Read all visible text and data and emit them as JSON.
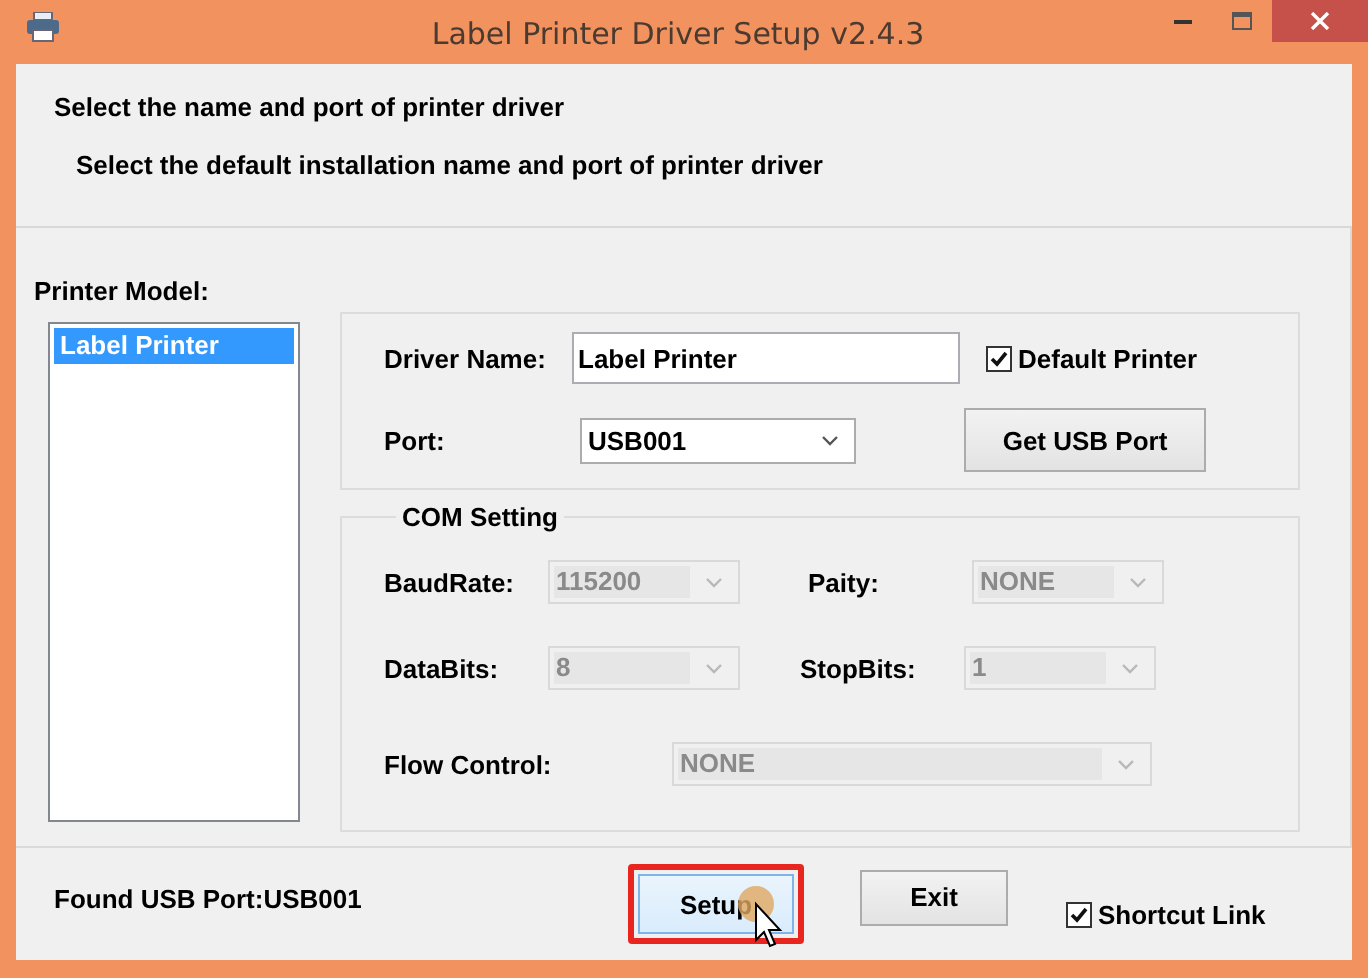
{
  "window": {
    "title": "Label Printer Driver Setup v2.4.3"
  },
  "header": {
    "heading": "Select the name and port of printer driver",
    "subheading": "Select the default installation name and port of printer driver"
  },
  "printer_model": {
    "label": "Printer Model:",
    "items": [
      {
        "label": "Label Printer",
        "selected": true
      }
    ]
  },
  "driver": {
    "name_label": "Driver Name:",
    "name_value": "Label Printer",
    "default_printer": {
      "label": "Default Printer",
      "checked": true
    },
    "port_label": "Port:",
    "port_value": "USB001",
    "get_port_button": "Get USB Port"
  },
  "com_setting": {
    "title": "COM Setting",
    "fields": [
      {
        "label": "BaudRate:",
        "value": "115200",
        "disabled": true
      },
      {
        "label": "Paity:",
        "value": "NONE",
        "disabled": true
      },
      {
        "label": "DataBits:",
        "value": "8",
        "disabled": true
      },
      {
        "label": "StopBits:",
        "value": "1",
        "disabled": true
      },
      {
        "label": "Flow Control:",
        "value": "NONE",
        "disabled": true
      }
    ]
  },
  "status": "Found USB Port:USB001",
  "buttons": [
    {
      "label": "Setup",
      "hovered": true,
      "annotated": true
    },
    {
      "label": "Exit",
      "hovered": false,
      "annotated": false
    }
  ],
  "shortcut_link": {
    "label": "Shortcut Link",
    "checked": true
  }
}
